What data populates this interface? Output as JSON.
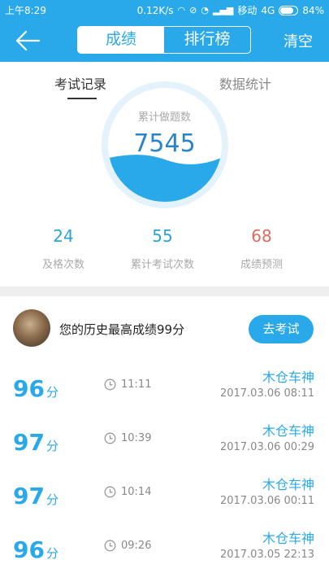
{
  "status_bar": {
    "time": "上午8:29",
    "net_speed": "0.12K/s",
    "carrier": "移动",
    "network": "4G",
    "battery": "84%"
  },
  "header": {
    "tabs": [
      "成绩",
      "排行榜"
    ],
    "active_tab": 0,
    "clear_label": "清空"
  },
  "subtabs": [
    "考试记录",
    "数据统计"
  ],
  "summary": {
    "label": "累计做题数",
    "value": "7545"
  },
  "stats": [
    {
      "value": "24",
      "label": "及格次数",
      "color": "#2aa2d8"
    },
    {
      "value": "55",
      "label": "累计考试次数",
      "color": "#2aa2d8"
    },
    {
      "value": "68",
      "label": "成绩预测",
      "color": "#e06a5f"
    }
  ],
  "profile": {
    "best_text": "您的历史最高成绩99分",
    "button_label": "去考试"
  },
  "records": [
    {
      "score": "96",
      "unit": "分",
      "duration": "11:11",
      "name": "木仓车神",
      "date": "2017.03.06  08:11"
    },
    {
      "score": "97",
      "unit": "分",
      "duration": "10:39",
      "name": "木仓车神",
      "date": "2017.03.06  00:29"
    },
    {
      "score": "97",
      "unit": "分",
      "duration": "10:14",
      "name": "木仓车神",
      "date": "2017.03.06  00:11"
    },
    {
      "score": "96",
      "unit": "分",
      "duration": "09:26",
      "name": "木仓车神",
      "date": "2017.03.05  22:13"
    }
  ],
  "colors": {
    "primary": "#29a9ea",
    "circle_ring": "#e3f2fb",
    "wave": "#29a9ea"
  }
}
